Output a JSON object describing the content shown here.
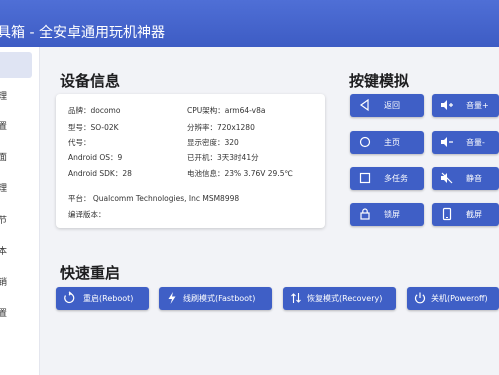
{
  "window": {
    "title": "具箱 - 全安卓通用玩机神器"
  },
  "sidebar": {
    "items": [
      {
        "label": ""
      },
      {
        "label": "理"
      },
      {
        "label": "置"
      },
      {
        "label": "面"
      },
      {
        "label": "理"
      },
      {
        "label": "节"
      },
      {
        "label": "本"
      },
      {
        "label": "销"
      },
      {
        "label": "置"
      }
    ]
  },
  "device_info": {
    "title": "设备信息",
    "rows": [
      {
        "left": "品牌：docomo",
        "right": "CPU架构：arm64-v8a"
      },
      {
        "left": "型号：SO-02K",
        "right": "分辨率：720x1280"
      },
      {
        "left": "代号：",
        "right": "显示密度：320"
      },
      {
        "left": "Android OS：9",
        "right": "已开机：3天3时41分"
      },
      {
        "left": "Android SDK：28",
        "right": "电池信息：23%  3.76V  29.5℃"
      }
    ],
    "platform": "平台：  Qualcomm Technologies, Inc MSM8998",
    "build": "编译版本："
  },
  "key_sim": {
    "title": "按键模拟",
    "buttons": [
      {
        "label": "返回",
        "icon": "back-triangle-icon"
      },
      {
        "label": "音量+",
        "icon": "volume-up-icon"
      },
      {
        "label": "主页",
        "icon": "home-circle-icon"
      },
      {
        "label": "音量-",
        "icon": "volume-down-icon"
      },
      {
        "label": "多任务",
        "icon": "recents-square-icon"
      },
      {
        "label": "静音",
        "icon": "mute-icon"
      },
      {
        "label": "锁屏",
        "icon": "lock-icon"
      },
      {
        "label": "截屏",
        "icon": "screenshot-icon"
      }
    ]
  },
  "quick_reboot": {
    "title": "快速重启",
    "buttons": [
      {
        "label": "重启(Reboot)",
        "icon": "restart-icon"
      },
      {
        "label": "线刷模式(Fastboot)",
        "icon": "flash-icon"
      },
      {
        "label": "恢复模式(Recovery)",
        "icon": "recovery-icon"
      },
      {
        "label": "关机(Poweroff)",
        "icon": "power-icon"
      }
    ]
  },
  "colors": {
    "accent": "#3f5fc6",
    "titlebar": "#4a69d0",
    "background": "#f2f3f7"
  }
}
